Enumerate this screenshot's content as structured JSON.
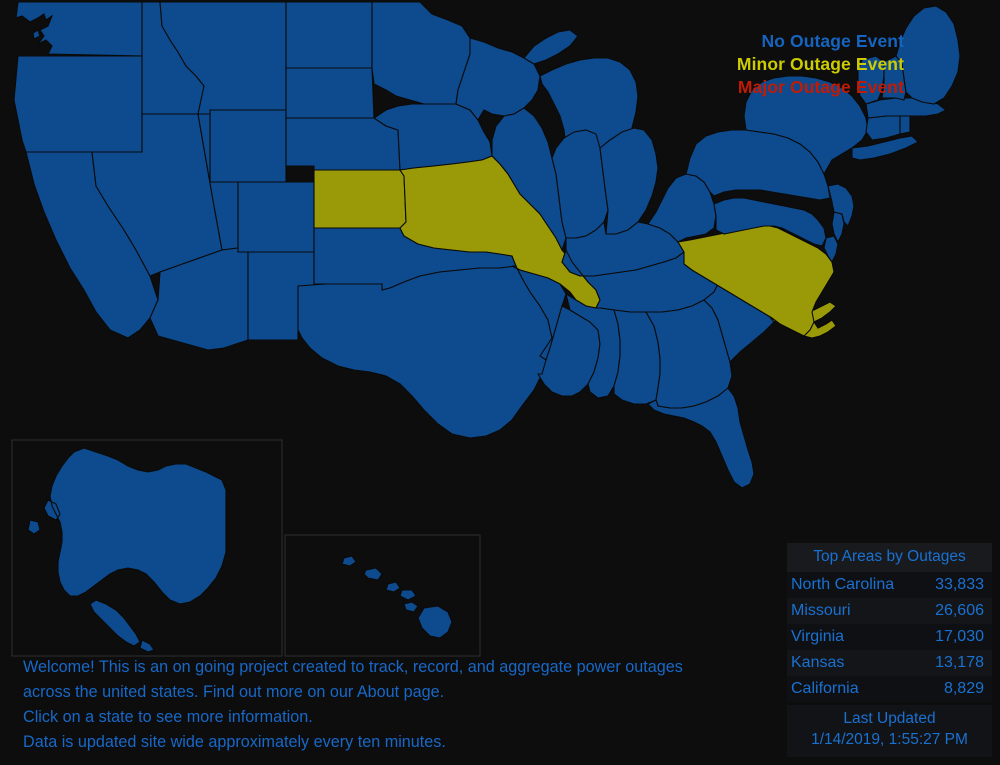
{
  "legend": {
    "items": [
      {
        "label": "No Outage Event",
        "status": "none",
        "color": "#1565c0"
      },
      {
        "label": "Minor Outage Event",
        "status": "minor",
        "color": "#cccc00"
      },
      {
        "label": "Major Outage Event",
        "status": "major",
        "color": "#c11a05"
      }
    ]
  },
  "map": {
    "background_color": "#0d0d0d",
    "no_outage_color": "#0d4b8e",
    "minor_outage_color": "#9a9a09",
    "major_outage_color": "#b21a0c",
    "border_color": "#0a0a0a",
    "minor_outage_states": [
      "Kansas",
      "Missouri",
      "Virginia",
      "North Carolina"
    ],
    "major_outage_states": [],
    "insets": [
      "Alaska",
      "Hawaii"
    ]
  },
  "top_areas": {
    "title": "Top Areas by Outages",
    "rows": [
      {
        "name": "North Carolina",
        "value": "33,833"
      },
      {
        "name": "Missouri",
        "value": "26,606"
      },
      {
        "name": "Virginia",
        "value": "17,030"
      },
      {
        "name": "Kansas",
        "value": "13,178"
      },
      {
        "name": "California",
        "value": "8,829"
      }
    ]
  },
  "last_updated": {
    "title": "Last Updated",
    "timestamp": "1/14/2019, 1:55:27 PM"
  },
  "welcome": {
    "line1": "Welcome! This is an on going project created to track, record, and aggregate power outages",
    "line2": "across the united states. Find out more on our About page.",
    "line3": "Click on a state to see more information.",
    "line4": "Data is updated site wide approximately every ten minutes."
  }
}
